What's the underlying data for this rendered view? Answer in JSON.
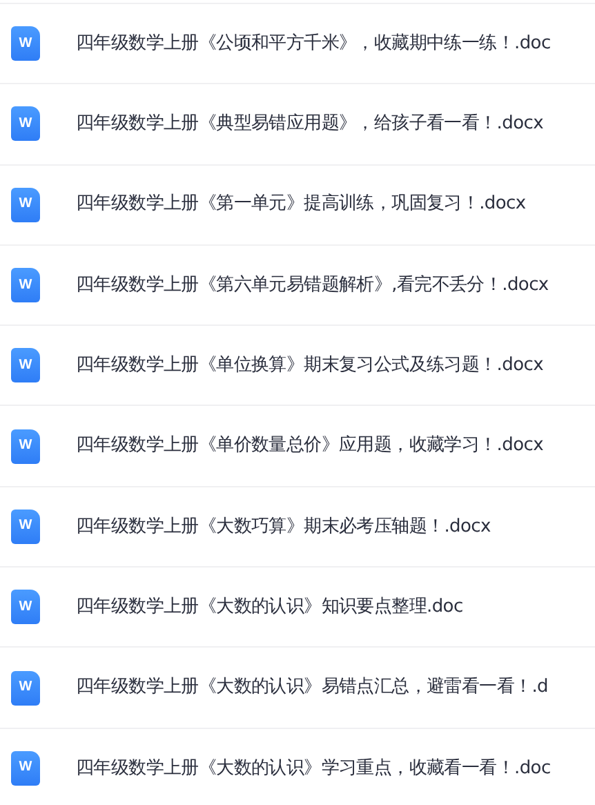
{
  "files": [
    {
      "icon_text": "W",
      "name": "四年级数学上册《公顷和平方千米》，收藏期中练一练！.doc"
    },
    {
      "icon_text": "W",
      "name": "四年级数学上册《典型易错应用题》，给孩子看一看！.docx"
    },
    {
      "icon_text": "W",
      "name": "四年级数学上册《第一单元》提高训练，巩固复习！.docx"
    },
    {
      "icon_text": "W",
      "name": "四年级数学上册《第六单元易错题解析》,看完不丢分！.docx"
    },
    {
      "icon_text": "W",
      "name": "四年级数学上册《单位换算》期末复习公式及练习题！.docx"
    },
    {
      "icon_text": "W",
      "name": "四年级数学上册《单价数量总价》应用题，收藏学习！.docx"
    },
    {
      "icon_text": "W",
      "name": "四年级数学上册《大数巧算》期末必考压轴题！.docx"
    },
    {
      "icon_text": "W",
      "name": "四年级数学上册《大数的认识》知识要点整理.doc"
    },
    {
      "icon_text": "W",
      "name": "四年级数学上册《大数的认识》易错点汇总，避雷看一看！.d"
    },
    {
      "icon_text": "W",
      "name": "四年级数学上册《大数的认识》学习重点，收藏看一看！.doc"
    }
  ]
}
